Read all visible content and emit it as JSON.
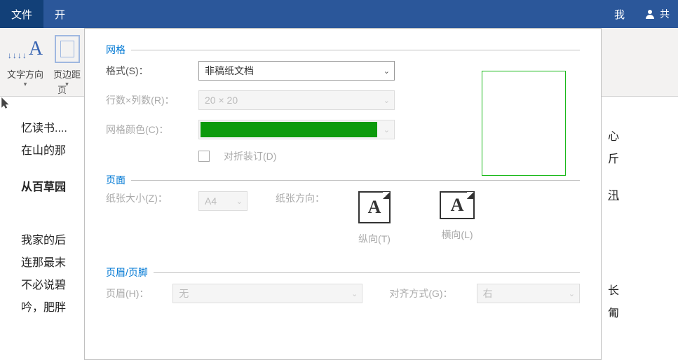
{
  "titlebar": {
    "file_tab": "文件",
    "second_tab": "开",
    "right1": "我",
    "share_label": "共"
  },
  "ribbon": {
    "text_direction_label": "文字方向",
    "margins_label": "页边距",
    "footer_partial": "页"
  },
  "doc_left": {
    "l1": "忆读书....",
    "l2": "在山的那",
    "l3": "从百草园",
    "l4": "我家的后",
    "l5": "连那最末",
    "l6": "不必说碧",
    "l7": "吟，肥胖"
  },
  "doc_right": {
    "r1": "心",
    "r2": "斤",
    "r3": "汛",
    "r4": "长",
    "r5": "匍"
  },
  "dialog": {
    "grid_section": "网格",
    "format_label": "格式(S)：",
    "format_value": "非稿纸文档",
    "rows_label": "行数×列数(R)：",
    "rows_value": "20 × 20",
    "color_label": "网格颜色(C)：",
    "fold_label": "对折装订(D)",
    "page_section": "页面",
    "paper_size_label": "纸张大小(Z)：",
    "paper_size_value": "A4",
    "orientation_label": "纸张方向：",
    "portrait_label": "纵向(T)",
    "landscape_label": "横向(L)",
    "hf_section": "页眉/页脚",
    "header_label": "页眉(H)：",
    "header_value": "无",
    "align_label": "对齐方式(G)：",
    "align_value": "右"
  }
}
